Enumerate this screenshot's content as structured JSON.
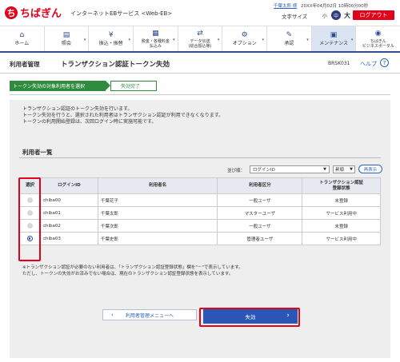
{
  "header": {
    "logo_mark": "ち",
    "logo_text": "ちばぎん",
    "service_name": "インターネットEBサービス <Web-EB>",
    "user_name": "千葉太郎 様",
    "last_login": "20XX年04月02日 10時00分00秒",
    "font_size_label": "文字サイズ",
    "font_sizes": [
      "小",
      "中",
      "大"
    ],
    "logout_label": "ログアウト"
  },
  "nav": {
    "items": [
      {
        "label": "ホーム",
        "icon": "home-icon"
      },
      {
        "label": "照会",
        "icon": "document-icon"
      },
      {
        "label": "振込・振替",
        "icon": "yen-icon"
      },
      {
        "label": "税金・各種料金\n払込み",
        "icon": "payment-icon"
      },
      {
        "label": "データ伝送\n(総合振込等)",
        "icon": "transfer-icon"
      },
      {
        "label": "オプション",
        "icon": "gear-icon"
      },
      {
        "label": "承認",
        "icon": "approve-icon"
      },
      {
        "label": "メンテナンス",
        "icon": "maintenance-icon"
      },
      {
        "label": "ちばぎん\nビジネスポータル",
        "icon": "portal-icon"
      }
    ]
  },
  "titlebar": {
    "section": "利用者管理",
    "title": "トランザクション認証トークン失効",
    "code": "BRSK031",
    "help": "ヘルプ"
  },
  "steps": {
    "step1": "トークン失効の対象利用者を選択",
    "step2": "失効完了"
  },
  "description": [
    "トランザクション認証のトークン失効を行います。",
    "トークン失効を行うと、選択された利用者はトランザクション認証が利用できなくなります。",
    "トークンの利用開始登録は、次回ログイン時に実施可能です。"
  ],
  "list": {
    "title": "利用者一覧",
    "sort_label": "並び順：",
    "sort_value": "ログインID",
    "order_value": "昇順",
    "redisplay_label": "再表示",
    "columns": [
      "選択",
      "ログインID",
      "利用者名",
      "利用者区分",
      "トランザクション認証\n登録状態"
    ],
    "rows": [
      {
        "login_id": "chiba00",
        "name": "千葉花子",
        "kind": "一般ユーザ",
        "status": "未登録",
        "selected": false
      },
      {
        "login_id": "chiba01",
        "name": "千葉太郎",
        "kind": "マスターユーザ",
        "status": "サービス利用中",
        "selected": false
      },
      {
        "login_id": "chiba02",
        "name": "千葉次郎",
        "kind": "一般ユーザ",
        "status": "未登録",
        "selected": false
      },
      {
        "login_id": "chiba03",
        "name": "千葉史郎",
        "kind": "管理者ユーザ",
        "status": "サービス利用中",
        "selected": true
      }
    ]
  },
  "notes": [
    "※トランザクション認証が必要のない利用者は、「トランザクション認証登録状態」欄を\"－\"で表示しています。",
    "ただし、トークンの失効がお済みでない場合は、現在のトランザクション認証登録状態を表示しています。"
  ],
  "buttons": {
    "back": "利用者管理メニューへ",
    "execute": "失効"
  },
  "colors": {
    "brand_red": "#e3001b",
    "navy": "#2f4c8e",
    "step_green": "#2f8c3f",
    "button_blue": "#2a57b5"
  }
}
